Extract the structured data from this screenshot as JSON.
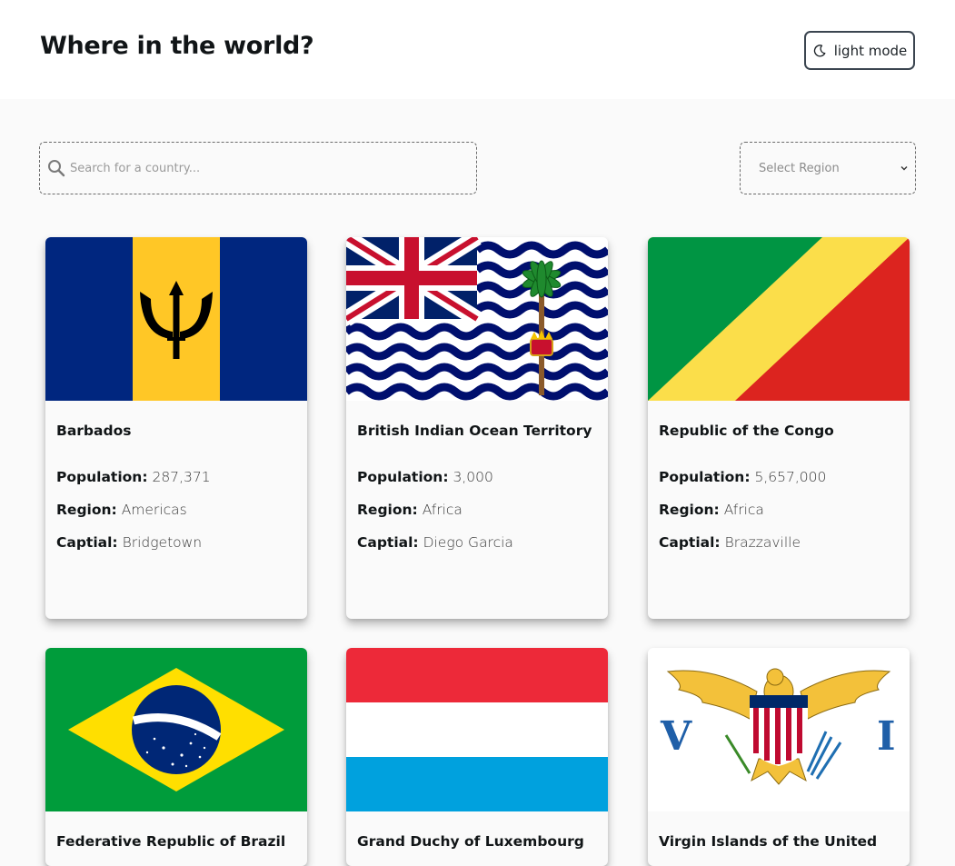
{
  "header": {
    "title": "Where in the world?",
    "mode_label": "light mode"
  },
  "search": {
    "placeholder": "Search for a country..."
  },
  "filter": {
    "selected": "Select Region"
  },
  "labels": {
    "population": "Population:",
    "region": "Region:",
    "capital": "Captial:"
  },
  "countries": [
    {
      "name": "Barbados",
      "population": "287,371",
      "region": "Americas",
      "capital": "Bridgetown",
      "flag": "barbados-flag"
    },
    {
      "name": "British Indian Ocean Territory",
      "population": "3,000",
      "region": "Africa",
      "capital": "Diego Garcia",
      "flag": "biot-flag"
    },
    {
      "name": "Republic of the Congo",
      "population": "5,657,000",
      "region": "Africa",
      "capital": "Brazzaville",
      "flag": "congo-flag"
    },
    {
      "name": "Federative Republic of Brazil",
      "flag": "brazil-flag"
    },
    {
      "name": "Grand Duchy of Luxembourg",
      "flag": "luxembourg-flag"
    },
    {
      "name": "Virgin Islands of the United",
      "flag": "usvi-flag"
    }
  ],
  "colors": {
    "background": "#fafafa",
    "header": "#ffffff",
    "text": "#111517"
  }
}
